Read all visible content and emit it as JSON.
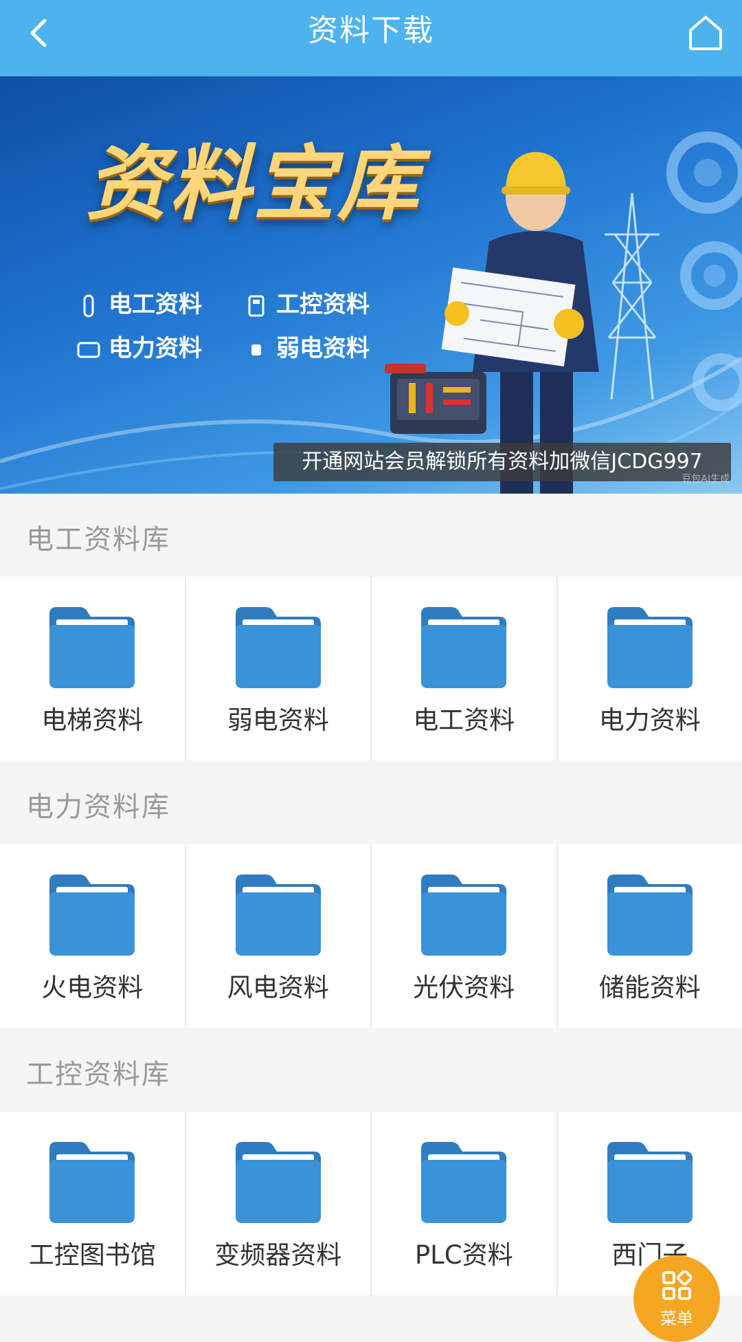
{
  "header": {
    "title": "资料下载"
  },
  "banner": {
    "title": "资料宝库",
    "tags": [
      "电工资料",
      "工控资料",
      "电力资料",
      "弱电资料"
    ],
    "notice": "开通网站会员解锁所有资料加微信JCDG997",
    "watermark": "豆包AI生成"
  },
  "sections": [
    {
      "title": "电工资料库",
      "items": [
        "电梯资料",
        "弱电资料",
        "电工资料",
        "电力资料"
      ]
    },
    {
      "title": "电力资料库",
      "items": [
        "火电资料",
        "风电资料",
        "光伏资料",
        "储能资料"
      ]
    },
    {
      "title": "工控资料库",
      "items": [
        "工控图书馆",
        "变频器资料",
        "PLC资料",
        "西门子"
      ]
    }
  ],
  "fab": {
    "label": "菜单"
  },
  "colors": {
    "header": "#4db3ee",
    "folder": "#3a8fd6",
    "fab": "#f6a623"
  }
}
